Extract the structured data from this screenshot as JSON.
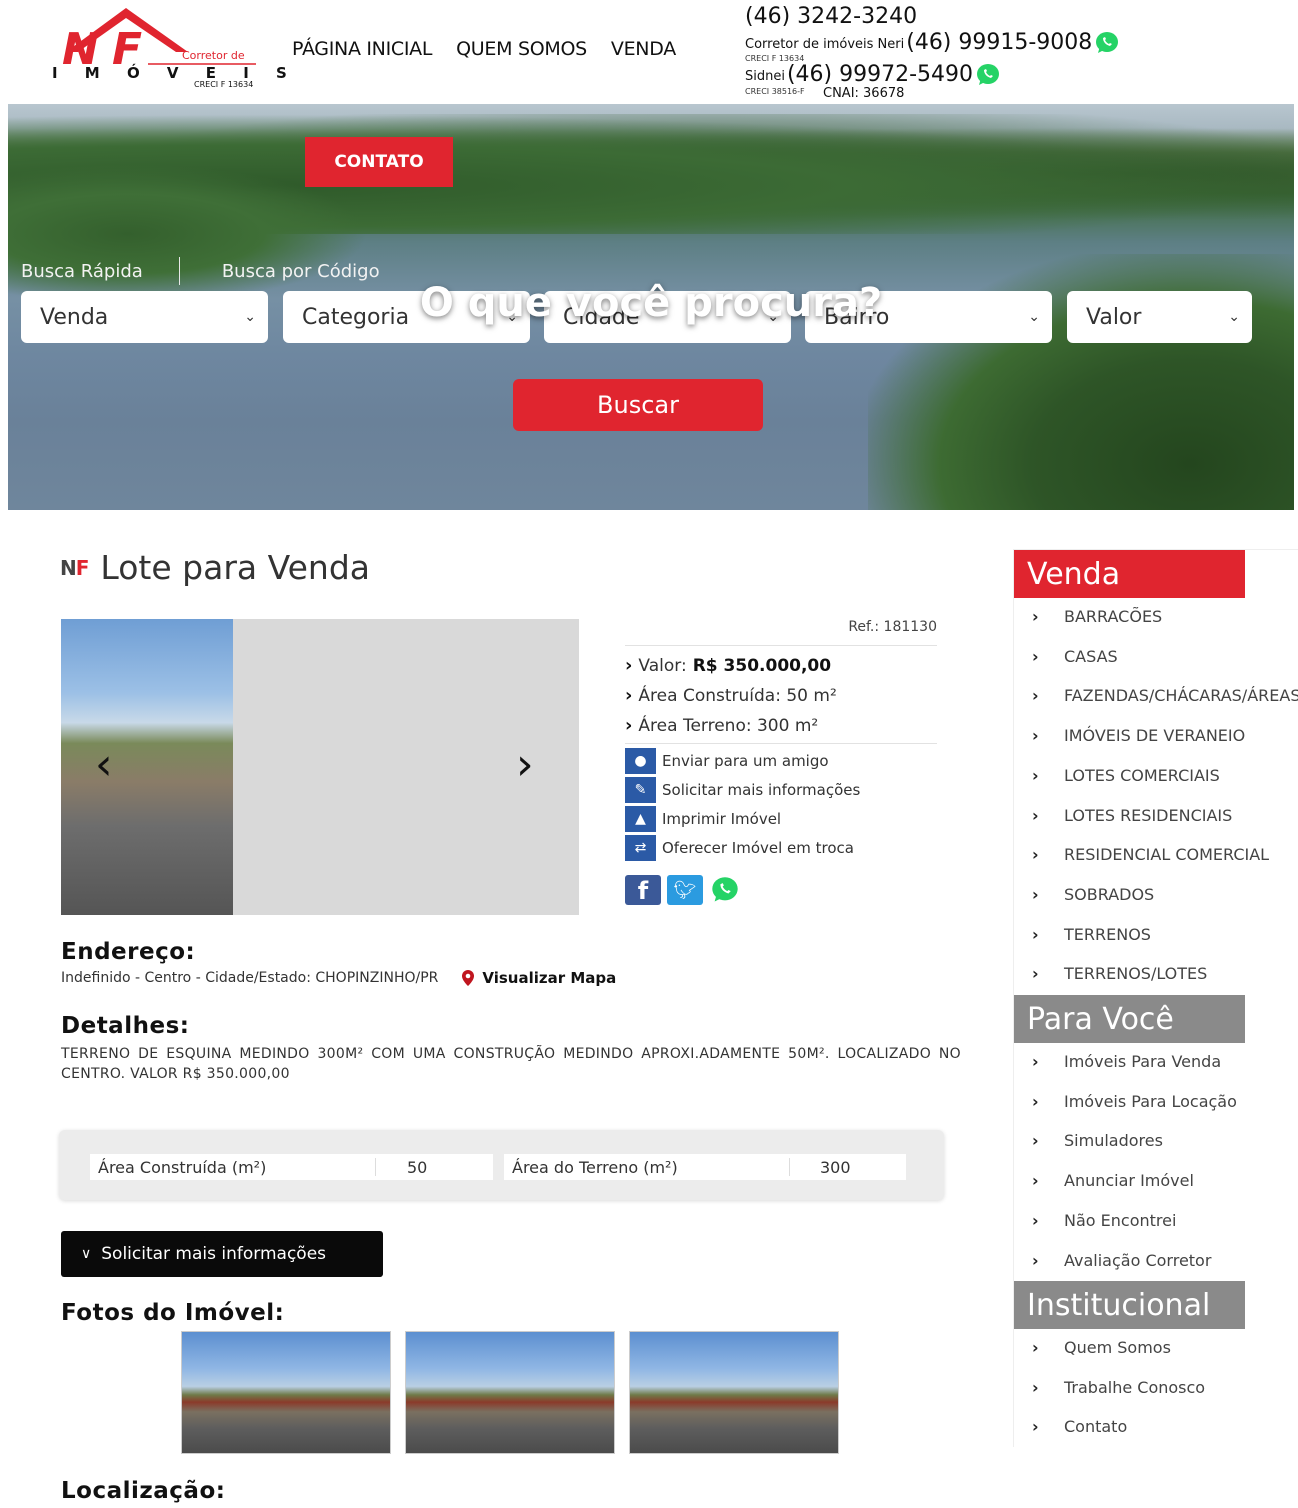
{
  "brand": {
    "logo_letters": "NF",
    "logo_word": "I M Ó V E I S",
    "logo_tag": "Corretor de",
    "logo_creci": "CRECI F 13634",
    "red": "#e0252f"
  },
  "nav": [
    "PÁGINA INICIAL",
    "QUEM SOMOS",
    "VENDA"
  ],
  "contacts": {
    "main_phone": "(46) 3242-3240",
    "neri_label": "Corretor de imóveis Neri",
    "neri_phone": "(46) 99915-9008",
    "neri_creci": "CRECI F 13634",
    "sidnei_label": "Sidnei",
    "sidnei_phone": "(46) 99972-5490",
    "sidnei_creci": "CRECI 38516-F",
    "cnai": "CNAI: 36678",
    "whatsapp_icon": "whatsapp-icon"
  },
  "hero": {
    "contato": "CONTATO",
    "title": "O que você procura?",
    "tabs": [
      "Busca Rápida",
      "Busca por Código"
    ],
    "selects": [
      "Venda",
      "Categoria",
      "Cidade",
      "Bairro",
      "Valor"
    ],
    "search_button": "Buscar"
  },
  "property": {
    "title": "Lote para Venda",
    "ref": "Ref.: 181130",
    "valor_label": "Valor:",
    "valor": "R$ 350.000,00",
    "area_construida": "Área Construída: 50 m²",
    "area_terreno": "Área Terreno: 300 m²",
    "actions": [
      "Enviar para um amigo",
      "Solicitar mais informações",
      "Imprimir Imóvel",
      "Oferecer Imóvel em troca"
    ],
    "endereco_title": "Endereço:",
    "endereco": "Indefinido - Centro - Cidade/Estado: CHOPINZINHO/PR",
    "map_link": "Visualizar Mapa",
    "detalhes_title": "Detalhes:",
    "detalhes": "TERRENO DE ESQUINA MEDINDO 300M² COM UMA CONSTRUÇÃO MEDINDO APROXI.ADAMENTE 50M². LOCALIZADO NO CENTRO. VALOR R$ 350.000,00",
    "areas": [
      {
        "label": "Área Construída (m²)",
        "value": "50"
      },
      {
        "label": "Área do Terreno (m²)",
        "value": "300"
      }
    ],
    "solicitar_button": "Solicitar mais informações",
    "fotos_title": "Fotos do Imóvel:",
    "localizacao_title": "Localização:"
  },
  "sidebar": {
    "venda_title": "Venda",
    "venda_items": [
      "BARRACÕES",
      "CASAS",
      "FAZENDAS/CHÁCARAS/ÁREAS",
      "IMÓVEIS DE VERANEIO",
      "LOTES COMERCIAIS",
      "LOTES RESIDENCIAIS",
      "RESIDENCIAL COMERCIAL",
      "SOBRADOS",
      "TERRENOS",
      "TERRENOS/LOTES"
    ],
    "paravoce_title": "Para Você",
    "paravoce_items": [
      "Imóveis Para Venda",
      "Imóveis Para Locação",
      "Simuladores",
      "Anunciar Imóvel",
      "Não Encontrei",
      "Avaliação Corretor"
    ],
    "inst_title": "Institucional",
    "inst_items": [
      "Quem Somos",
      "Trabalhe Conosco",
      "Contato"
    ],
    "head_red": "#e0252f",
    "head_gray": "#8a8a8a"
  }
}
